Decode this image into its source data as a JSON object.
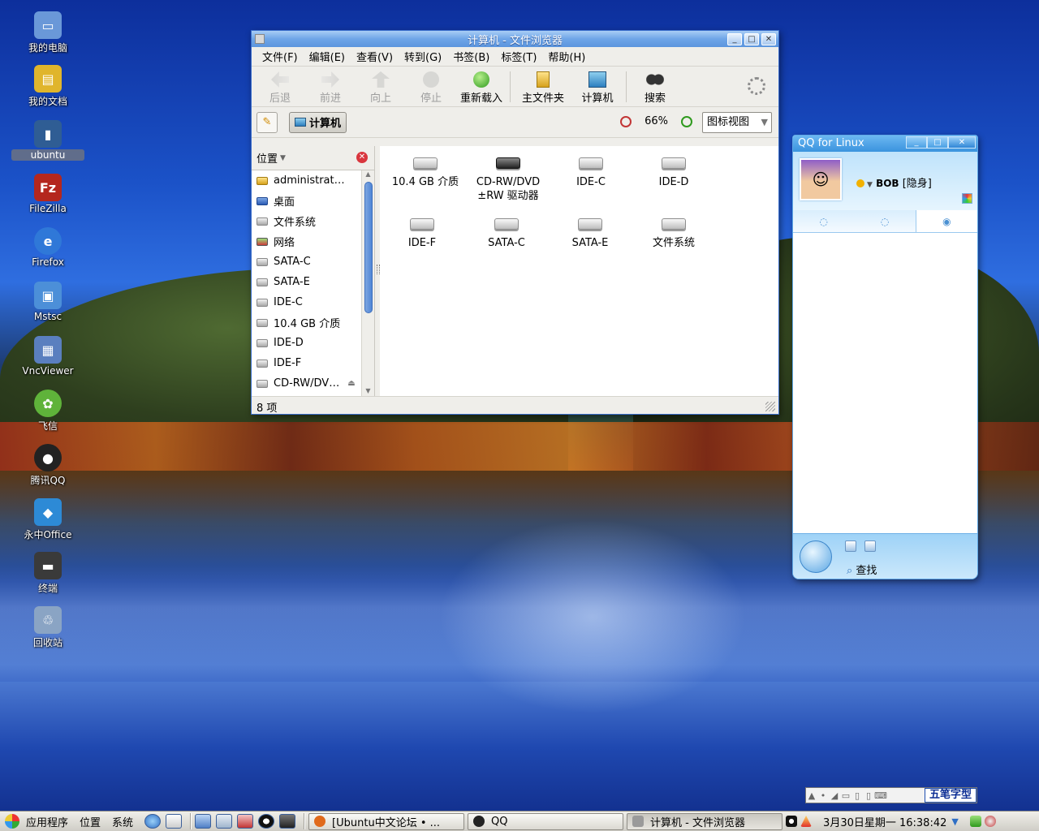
{
  "desktop": {
    "icons": [
      {
        "label": "我的电脑",
        "icon": "computer-icon",
        "color": "#6a98d8"
      },
      {
        "label": "我的文档",
        "icon": "documents-folder-icon",
        "color": "#e0b52c"
      },
      {
        "label": "ubuntu",
        "icon": "folder-icon",
        "color": "#2f5d94"
      },
      {
        "label": "FileZilla",
        "icon": "filezilla-icon",
        "color": "#b4271e"
      },
      {
        "label": "Firefox",
        "icon": "firefox-icon",
        "color": "#2f78d8"
      },
      {
        "label": "Mstsc",
        "icon": "remote-desktop-icon",
        "color": "#4c8fd8"
      },
      {
        "label": "VncViewer",
        "icon": "vnc-viewer-icon",
        "color": "#5a7fbf"
      },
      {
        "label": "飞信",
        "icon": "fetion-icon",
        "color": "#5fb33a"
      },
      {
        "label": "腾讯QQ",
        "icon": "qq-penguin-icon",
        "color": "#222222"
      },
      {
        "label": "永中Office",
        "icon": "office-icon",
        "color": "#2d8ad6"
      },
      {
        "label": "终端",
        "icon": "terminal-icon",
        "color": "#3a3a3a"
      },
      {
        "label": "回收站",
        "icon": "trash-icon",
        "color": "#8aa4c4"
      }
    ]
  },
  "file_browser": {
    "title": "计算机 - 文件浏览器",
    "menu": [
      "文件(F)",
      "编辑(E)",
      "查看(V)",
      "转到(G)",
      "书签(B)",
      "标签(T)",
      "帮助(H)"
    ],
    "toolbar": {
      "back": "后退",
      "forward": "前进",
      "up": "向上",
      "stop": "停止",
      "reload": "重新载入",
      "home": "主文件夹",
      "computer": "计算机",
      "search": "搜索"
    },
    "location": {
      "path_button": "计算机",
      "zoom": "66%",
      "view_mode": "图标视图"
    },
    "sidebar": {
      "header": "位置",
      "items": [
        {
          "label": "administrat…",
          "kind": "folder"
        },
        {
          "label": "桌面",
          "kind": "desk"
        },
        {
          "label": "文件系统",
          "kind": "drive"
        },
        {
          "label": "网络",
          "kind": "net"
        },
        {
          "label": "SATA-C",
          "kind": "drive"
        },
        {
          "label": "SATA-E",
          "kind": "drive"
        },
        {
          "label": "IDE-C",
          "kind": "drive"
        },
        {
          "label": "10.4 GB 介质",
          "kind": "drive"
        },
        {
          "label": "IDE-D",
          "kind": "drive"
        },
        {
          "label": "IDE-F",
          "kind": "drive"
        },
        {
          "label": "CD-RW/DV…",
          "kind": "drive"
        }
      ]
    },
    "items": [
      {
        "line1": "10.4 GB 介质",
        "line2": ""
      },
      {
        "line1": "CD-RW/DVD",
        "line2": "±RW 驱动器"
      },
      {
        "line1": "IDE-C",
        "line2": ""
      },
      {
        "line1": "IDE-D",
        "line2": ""
      },
      {
        "line1": "IDE-F",
        "line2": ""
      },
      {
        "line1": "SATA-C",
        "line2": ""
      },
      {
        "line1": "SATA-E",
        "line2": ""
      },
      {
        "line1": "文件系统",
        "line2": ""
      }
    ],
    "status": "8 项"
  },
  "qq": {
    "title": "QQ for Linux",
    "nickname": "BOB",
    "status": "[隐身]",
    "search": "查找"
  },
  "ime": {
    "mode": "五笔字型"
  },
  "taskbar": {
    "menus": [
      "应用程序",
      "位置",
      "系统"
    ],
    "tasks": [
      {
        "label": "[Ubuntu中文论坛 • ...",
        "color": "#e06a1c"
      },
      {
        "label": "QQ",
        "color": "#222222"
      },
      {
        "label": "计算机 - 文件浏览器",
        "color": "#9a9a9a"
      }
    ],
    "clock": "3月30日星期一 16:38:42"
  }
}
